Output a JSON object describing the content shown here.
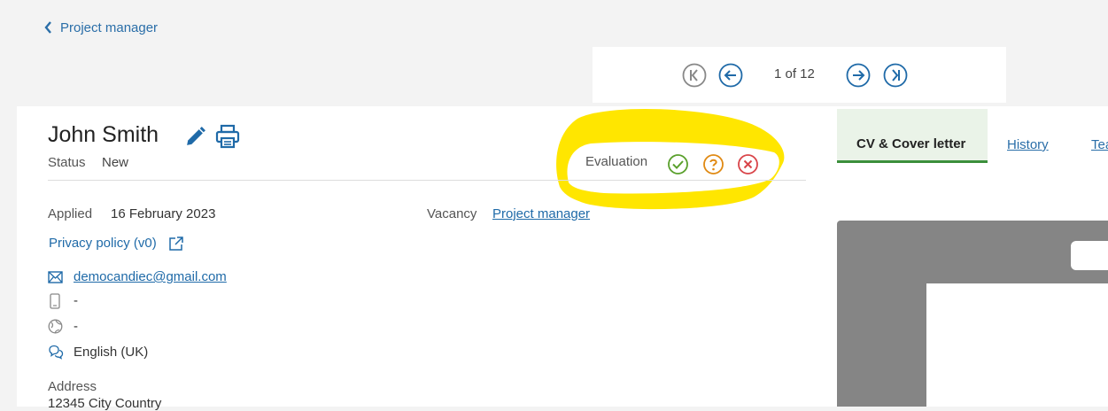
{
  "back": {
    "label": "Project manager"
  },
  "pager": {
    "text": "1 of 12"
  },
  "candidate": {
    "name": "John Smith",
    "status_label": "Status",
    "status_value": "New"
  },
  "evaluation": {
    "label": "Evaluation"
  },
  "details": {
    "applied_label": "Applied",
    "applied_value": "16 February 2023",
    "vacancy_label": "Vacancy",
    "vacancy_value": "Project manager",
    "privacy_label": "Privacy policy (v0)",
    "email": "democandiec@gmail.com",
    "phone": "-",
    "website": "-",
    "language": "English (UK)",
    "address_label": "Address",
    "address_value": "12345 City Country"
  },
  "tabs": {
    "cv": "CV & Cover letter",
    "history": "History",
    "team": "Tea"
  },
  "colors": {
    "accent_blue": "#1f6aa8",
    "positive": "#5aa02c",
    "neutral": "#e08a14",
    "negative": "#d9454a",
    "highlight": "#ffe600"
  }
}
